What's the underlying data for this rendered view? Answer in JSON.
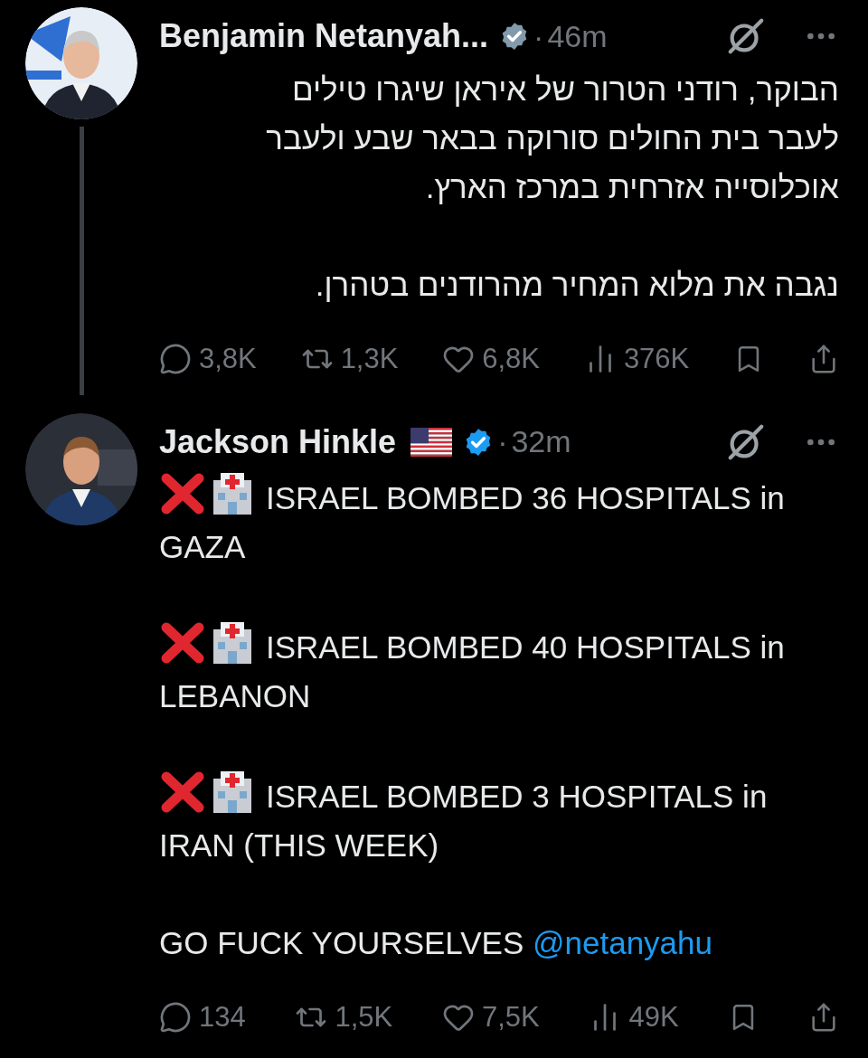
{
  "tweets": [
    {
      "author": "Benjamin Netanyah...",
      "badge": {
        "color": "#829aab"
      },
      "dot": "·",
      "time": "46m",
      "flag": false,
      "thread_line": true,
      "rtl": true,
      "paragraphs": [
        {
          "kind": "plain",
          "text": "הבוקר, רודני הטרור של איראן שיגרו טילים לעבר בית החולים סורוקה בבאר שבע ולעבר אוכלוסייה אזרחית במרכז הארץ."
        },
        {
          "kind": "plain",
          "text": "נגבה את מלוא המחיר מהרודנים בטהרן."
        }
      ],
      "stats": {
        "replies": "3,8K",
        "reposts": "1,3K",
        "likes": "6,8K",
        "views": "376K"
      }
    },
    {
      "author": "Jackson Hinkle",
      "badge": {
        "color": "#1d9bf0"
      },
      "dot": "·",
      "time": "32m",
      "flag": true,
      "thread_line": false,
      "rtl": false,
      "paragraphs": [
        {
          "kind": "alert",
          "text": "ISRAEL BOMBED 36 HOSPITALS in GAZA"
        },
        {
          "kind": "alert",
          "text": "ISRAEL BOMBED 40 HOSPITALS in LEBANON"
        },
        {
          "kind": "alert",
          "text": "ISRAEL BOMBED 3 HOSPITALS in IRAN (THIS WEEK)"
        },
        {
          "kind": "mention",
          "text": "GO FUCK YOURSELVES",
          "mention": "@netanyahu"
        }
      ],
      "stats": {
        "replies": "134",
        "reposts": "1,5K",
        "likes": "7,5K",
        "views": "49K"
      }
    }
  ]
}
